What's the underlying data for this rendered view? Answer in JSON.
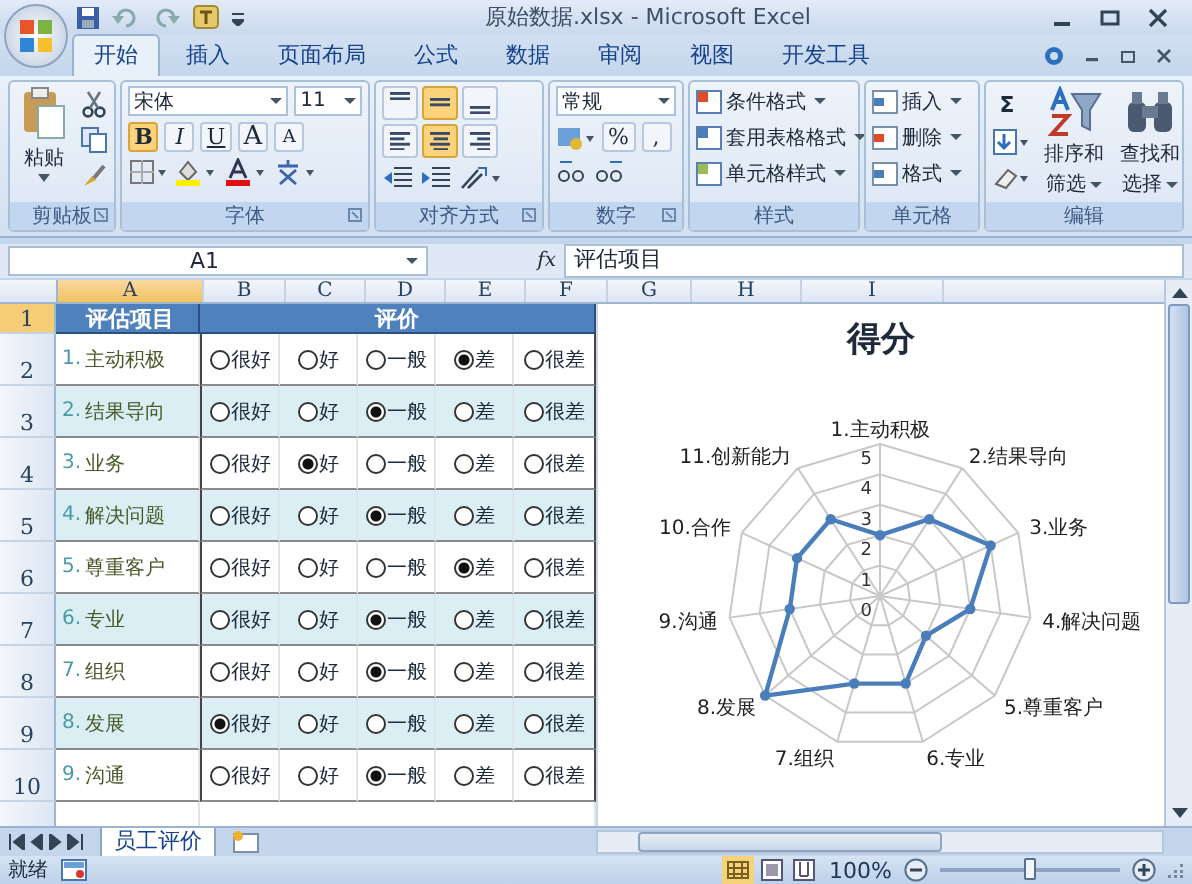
{
  "window": {
    "title": "原始数据.xlsx - Microsoft Excel"
  },
  "tabs": [
    {
      "label": "开始",
      "selected": true
    },
    {
      "label": "插入",
      "selected": false
    },
    {
      "label": "页面布局",
      "selected": false
    },
    {
      "label": "公式",
      "selected": false
    },
    {
      "label": "数据",
      "selected": false
    },
    {
      "label": "审阅",
      "selected": false
    },
    {
      "label": "视图",
      "selected": false
    },
    {
      "label": "开发工具",
      "selected": false
    }
  ],
  "ribbon": {
    "clipboard": {
      "paste": "粘贴",
      "caption": "剪贴板"
    },
    "font": {
      "font_name": "宋体",
      "font_size": "11",
      "bold": {
        "label": "B",
        "on": true
      },
      "italic": "I",
      "underline": "U",
      "grow": "A",
      "shrink": "A",
      "caption": "字体"
    },
    "alignment": {
      "caption": "对齐方式",
      "buttons": [
        {
          "kind": "top",
          "on": false
        },
        {
          "kind": "middle",
          "on": true
        },
        {
          "kind": "bottom",
          "on": false
        },
        {
          "kind": "left",
          "on": false
        },
        {
          "kind": "center",
          "on": true
        },
        {
          "kind": "right",
          "on": false
        }
      ]
    },
    "number": {
      "format": "常规",
      "percent": "%",
      "comma": ",",
      "caption": "数字"
    },
    "styles": {
      "items": [
        "条件格式",
        "套用表格格式",
        "单元格样式"
      ],
      "caption": "样式"
    },
    "cells": {
      "items": [
        "插入",
        "删除",
        "格式"
      ],
      "caption": "单元格"
    },
    "editing": {
      "sum": "Σ",
      "sort": [
        "排序和",
        "筛选"
      ],
      "find": [
        "查找和",
        "选择"
      ],
      "caption": "编辑"
    }
  },
  "formula_bar": {
    "name_box": "A1",
    "fx": "fx",
    "value": "评估项目"
  },
  "sheet": {
    "columns": [
      "A",
      "B",
      "C",
      "D",
      "E",
      "F",
      "G",
      "H",
      "I"
    ],
    "header": {
      "row": "1",
      "item": "评估项目",
      "rating": "评价"
    },
    "rows": [
      {
        "row": "2",
        "num": "1.",
        "item": "主动积极",
        "options": [
          {
            "label": "很好",
            "selected": false
          },
          {
            "label": "好",
            "selected": false
          },
          {
            "label": "一般",
            "selected": false
          },
          {
            "label": "差",
            "selected": true
          },
          {
            "label": "很差",
            "selected": false
          }
        ]
      },
      {
        "row": "3",
        "num": "2.",
        "item": "结果导向",
        "options": [
          {
            "label": "很好",
            "selected": false
          },
          {
            "label": "好",
            "selected": false
          },
          {
            "label": "一般",
            "selected": true
          },
          {
            "label": "差",
            "selected": false
          },
          {
            "label": "很差",
            "selected": false
          }
        ]
      },
      {
        "row": "4",
        "num": "3.",
        "item": "业务",
        "options": [
          {
            "label": "很好",
            "selected": false
          },
          {
            "label": "好",
            "selected": true
          },
          {
            "label": "一般",
            "selected": false
          },
          {
            "label": "差",
            "selected": false
          },
          {
            "label": "很差",
            "selected": false
          }
        ]
      },
      {
        "row": "5",
        "num": "4.",
        "item": "解决问题",
        "options": [
          {
            "label": "很好",
            "selected": false
          },
          {
            "label": "好",
            "selected": false
          },
          {
            "label": "一般",
            "selected": true
          },
          {
            "label": "差",
            "selected": false
          },
          {
            "label": "很差",
            "selected": false
          }
        ]
      },
      {
        "row": "6",
        "num": "5.",
        "item": "尊重客户",
        "options": [
          {
            "label": "很好",
            "selected": false
          },
          {
            "label": "好",
            "selected": false
          },
          {
            "label": "一般",
            "selected": false
          },
          {
            "label": "差",
            "selected": true
          },
          {
            "label": "很差",
            "selected": false
          }
        ]
      },
      {
        "row": "7",
        "num": "6.",
        "item": "专业",
        "options": [
          {
            "label": "很好",
            "selected": false
          },
          {
            "label": "好",
            "selected": false
          },
          {
            "label": "一般",
            "selected": true
          },
          {
            "label": "差",
            "selected": false
          },
          {
            "label": "很差",
            "selected": false
          }
        ]
      },
      {
        "row": "8",
        "num": "7.",
        "item": "组织",
        "options": [
          {
            "label": "很好",
            "selected": false
          },
          {
            "label": "好",
            "selected": false
          },
          {
            "label": "一般",
            "selected": true
          },
          {
            "label": "差",
            "selected": false
          },
          {
            "label": "很差",
            "selected": false
          }
        ]
      },
      {
        "row": "9",
        "num": "8.",
        "item": "发展",
        "options": [
          {
            "label": "很好",
            "selected": true
          },
          {
            "label": "好",
            "selected": false
          },
          {
            "label": "一般",
            "selected": false
          },
          {
            "label": "差",
            "selected": false
          },
          {
            "label": "很差",
            "selected": false
          }
        ]
      },
      {
        "row": "10",
        "num": "9.",
        "item": "沟通",
        "options": [
          {
            "label": "很好",
            "selected": false
          },
          {
            "label": "好",
            "selected": false
          },
          {
            "label": "一般",
            "selected": true
          },
          {
            "label": "差",
            "selected": false
          },
          {
            "label": "很差",
            "selected": false
          }
        ]
      }
    ]
  },
  "chart": {
    "chart_data": {
      "type": "radar",
      "title": "得分",
      "categories": [
        "1.主动积极",
        "2.结果导向",
        "3.业务",
        "4.解决问题",
        "5.尊重客户",
        "6.专业",
        "7.组织",
        "8.发展",
        "9.沟通",
        "10.合作",
        "11.创新能力"
      ],
      "series": [
        {
          "color": "#4a7ebb",
          "values": [
            2,
            3,
            4,
            3,
            2,
            3,
            3,
            5,
            3,
            3,
            3
          ]
        }
      ],
      "ylim": [
        0,
        5
      ],
      "yticks": [
        0,
        1,
        2,
        3,
        4,
        5
      ]
    }
  },
  "sheet_tabs": [
    {
      "label": "员工评价",
      "selected": true
    }
  ],
  "status_bar": {
    "status": "就绪",
    "zoom": "100%",
    "zoom_level": {
      "level": 0.5
    }
  }
}
